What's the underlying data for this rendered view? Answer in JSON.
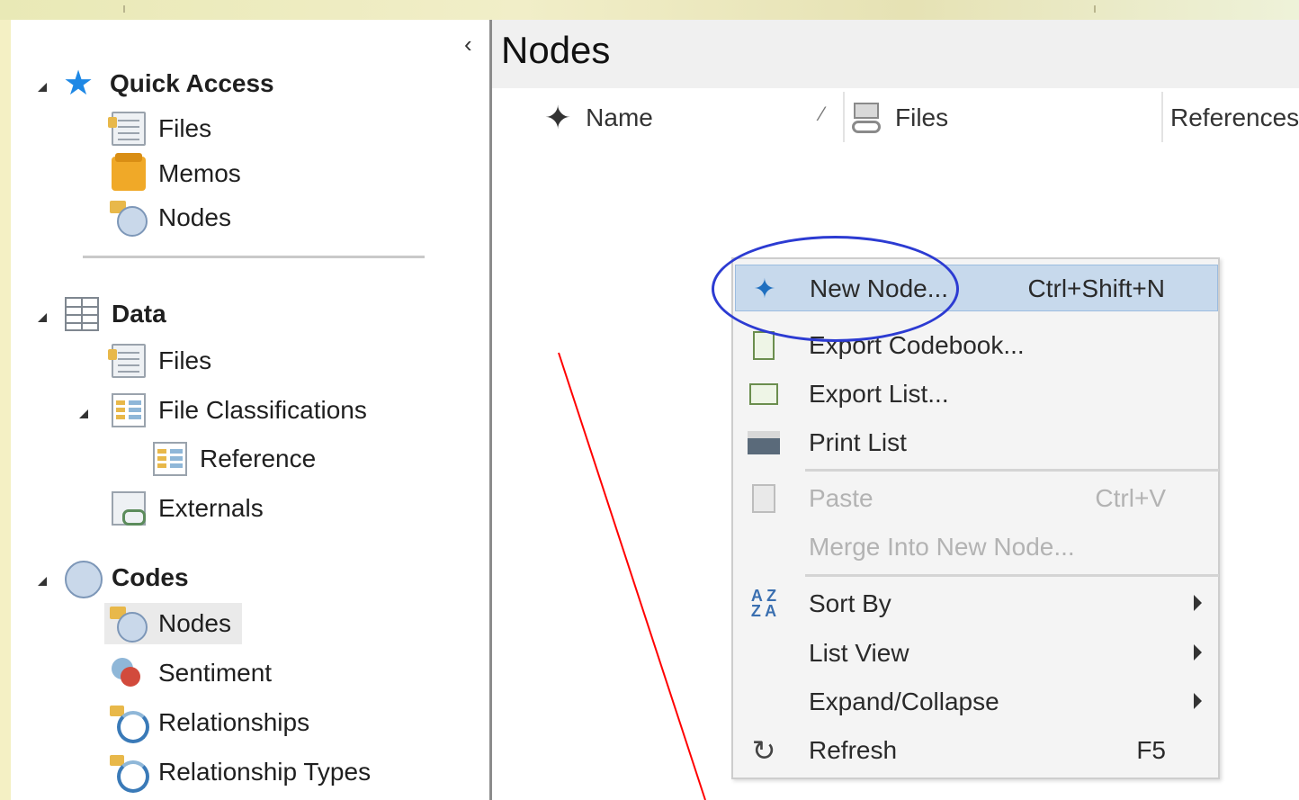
{
  "nav": {
    "collapse_glyph": "‹",
    "quick_access": {
      "label": "Quick Access",
      "items": [
        {
          "label": "Files",
          "icon": "file-icon"
        },
        {
          "label": "Memos",
          "icon": "memo-icon"
        },
        {
          "label": "Nodes",
          "icon": "node-icon"
        }
      ]
    },
    "data": {
      "label": "Data",
      "files": "Files",
      "file_classifications": "File Classifications",
      "reference": "Reference",
      "externals": "Externals"
    },
    "codes": {
      "label": "Codes",
      "items": [
        {
          "label": "Nodes",
          "icon": "node-icon"
        },
        {
          "label": "Sentiment",
          "icon": "sentiment-icon"
        },
        {
          "label": "Relationships",
          "icon": "relationship-icon"
        },
        {
          "label": "Relationship Types",
          "icon": "relationship-type-icon"
        }
      ]
    }
  },
  "main": {
    "title": "Nodes",
    "columns": [
      {
        "label": "Name"
      },
      {
        "label": "Files"
      },
      {
        "label": "References"
      }
    ]
  },
  "context_menu": {
    "items": [
      {
        "label": "New Node...",
        "shortcut": "Ctrl+Shift+N",
        "highlighted": true,
        "enabled": true,
        "icon": "new-node-icon"
      },
      {
        "label": "Export Codebook...",
        "enabled": true,
        "icon": "export-codebook-icon"
      },
      {
        "label": "Export List...",
        "enabled": true,
        "icon": "export-list-icon"
      },
      {
        "label": "Print List",
        "enabled": true,
        "icon": "print-icon"
      },
      {
        "label": "Paste",
        "shortcut": "Ctrl+V",
        "enabled": false,
        "icon": "paste-icon"
      },
      {
        "label": "Merge Into New Node...",
        "enabled": false
      },
      {
        "label": "Sort By",
        "enabled": true,
        "submenu": true,
        "icon": "sort-az-icon"
      },
      {
        "label": "List View",
        "enabled": true,
        "submenu": true
      },
      {
        "label": "Expand/Collapse",
        "enabled": true,
        "submenu": true
      },
      {
        "label": "Refresh",
        "shortcut": "F5",
        "enabled": true,
        "icon": "refresh-icon"
      }
    ]
  },
  "annotations": {
    "oval_color": "#2c3bd2",
    "line_color": "#ff0000"
  }
}
